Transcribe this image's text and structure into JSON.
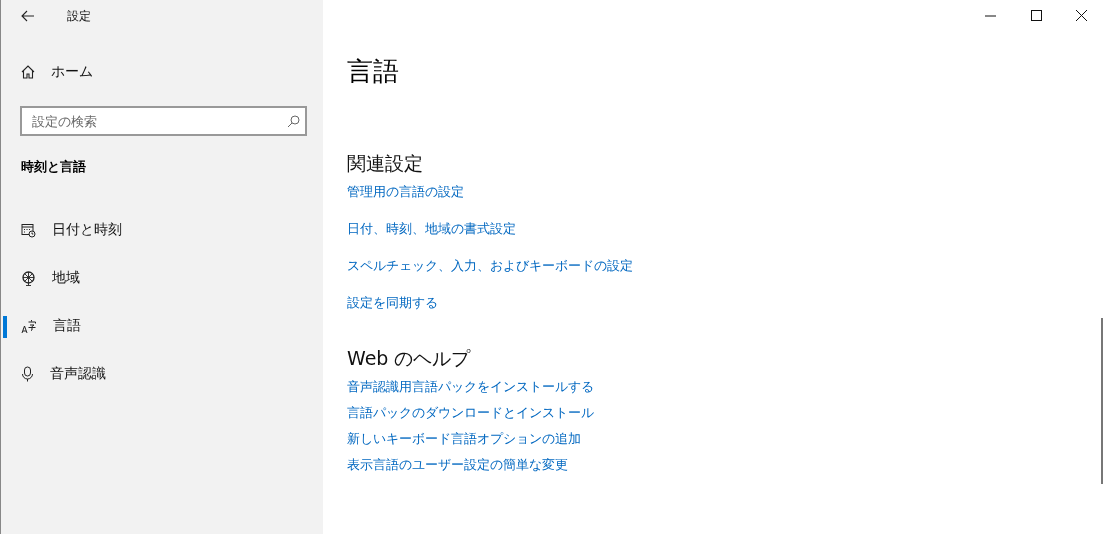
{
  "window": {
    "title": "設定"
  },
  "sidebar": {
    "home": "ホーム",
    "search": {
      "placeholder": "設定の検索"
    },
    "section": "時刻と言語",
    "items": [
      {
        "label": "日付と時刻",
        "kind": "calendar",
        "selected": false
      },
      {
        "label": "地域",
        "kind": "globe",
        "selected": false
      },
      {
        "label": "言語",
        "kind": "language",
        "selected": true
      },
      {
        "label": "音声認識",
        "kind": "mic",
        "selected": false
      }
    ]
  },
  "page": {
    "title": "言語",
    "sections": [
      {
        "heading": "関連設定",
        "links": [
          "管理用の言語の設定",
          "日付、時刻、地域の書式設定",
          "スペルチェック、入力、およびキーボードの設定",
          "設定を同期する"
        ]
      },
      {
        "heading": "Web のヘルプ",
        "links": [
          "音声認識用言語パックをインストールする",
          "言語パックのダウンロードとインストール",
          "新しいキーボード言語オプションの追加",
          "表示言語のユーザー設定の簡単な変更"
        ]
      }
    ]
  }
}
